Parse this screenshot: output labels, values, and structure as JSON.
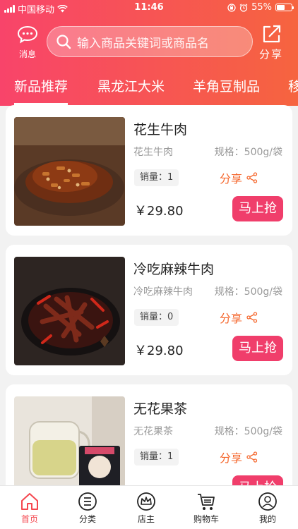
{
  "status_bar": {
    "carrier": "中国移动",
    "time": "11:46",
    "battery": "55%",
    "battery_level": 0.55
  },
  "header": {
    "message_label": "消息",
    "search_placeholder": "输入商品关键词或商品名",
    "share_label": "分享"
  },
  "tabs": [
    {
      "label": "新品推荐",
      "active": true
    },
    {
      "label": "黑龙江大米",
      "active": false
    },
    {
      "label": "羊角豆制品",
      "active": false
    },
    {
      "label": "移",
      "active": false
    }
  ],
  "products": [
    {
      "title": "花生牛肉",
      "subtitle": "花生牛肉",
      "spec": "规格：500g/袋",
      "sales": "销量：1",
      "share": "分享",
      "price": "￥29.80",
      "buy": "马上抢"
    },
    {
      "title": "冷吃麻辣牛肉",
      "subtitle": "冷吃麻辣牛肉",
      "spec": "规格：500g/袋",
      "sales": "销量：0",
      "share": "分享",
      "price": "￥29.80",
      "buy": "马上抢"
    },
    {
      "title": "无花果茶",
      "subtitle": "无花果茶",
      "spec": "规格：500g/袋",
      "sales": "销量：1",
      "share": "分享",
      "price": "",
      "buy": "马上抢"
    }
  ],
  "tabbar": [
    {
      "label": "首页",
      "icon": "home-icon",
      "active": true
    },
    {
      "label": "分类",
      "icon": "category-icon",
      "active": false
    },
    {
      "label": "店主",
      "icon": "crown-icon",
      "active": false
    },
    {
      "label": "购物车",
      "icon": "cart-icon",
      "active": false
    },
    {
      "label": "我的",
      "icon": "user-icon",
      "active": false
    }
  ],
  "colors": {
    "header_start": "#f8446a",
    "header_end": "#f6643f",
    "buy_button": "#f03e6b",
    "share_text": "#f5672d",
    "active_tab": "#f5474f"
  }
}
